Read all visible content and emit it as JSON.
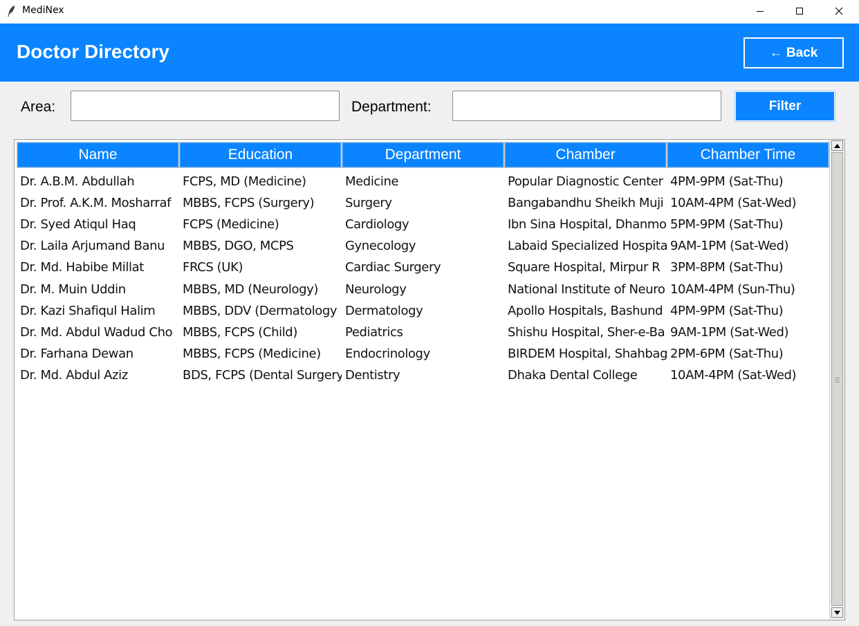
{
  "window": {
    "app_title": "MediNex",
    "icons": {
      "app": "feather-icon",
      "minimize": "minimize-icon",
      "maximize": "maximize-icon",
      "close": "close-icon"
    }
  },
  "header": {
    "title": "Doctor Directory",
    "back_label": "← Back"
  },
  "filters": {
    "area_label": "Area:",
    "area_value": "",
    "department_label": "Department:",
    "department_value": "",
    "filter_label": "Filter"
  },
  "table": {
    "columns": [
      "Name",
      "Education",
      "Department",
      "Chamber",
      "Chamber Time"
    ],
    "rows": [
      [
        "Dr. A.B.M. Abdullah",
        "FCPS, MD (Medicine)",
        "Medicine",
        "Popular Diagnostic Center",
        "4PM-9PM (Sat-Thu)"
      ],
      [
        "Dr. Prof. A.K.M. Mosharraf",
        "MBBS, FCPS (Surgery)",
        "Surgery",
        "Bangabandhu Sheikh Muji",
        "10AM-4PM (Sat-Wed)"
      ],
      [
        "Dr. Syed Atiqul Haq",
        "FCPS (Medicine)",
        "Cardiology",
        "Ibn Sina Hospital, Dhanmo",
        "5PM-9PM (Sat-Thu)"
      ],
      [
        "Dr. Laila Arjumand Banu",
        "MBBS, DGO, MCPS",
        "Gynecology",
        "Labaid Specialized Hospita",
        "9AM-1PM (Sat-Wed)"
      ],
      [
        "Dr. Md. Habibe Millat",
        "FRCS (UK)",
        "Cardiac Surgery",
        "Square Hospital, Mirpur R",
        "3PM-8PM (Sat-Thu)"
      ],
      [
        "Dr. M. Muin Uddin",
        "MBBS, MD (Neurology)",
        "Neurology",
        "National Institute of Neuro",
        "10AM-4PM (Sun-Thu)"
      ],
      [
        "Dr. Kazi Shafiqul Halim",
        "MBBS, DDV (Dermatology",
        "Dermatology",
        "Apollo Hospitals, Bashund",
        "4PM-9PM (Sat-Thu)"
      ],
      [
        "Dr. Md. Abdul Wadud Cho",
        "MBBS, FCPS (Child)",
        "Pediatrics",
        "Shishu Hospital, Sher-e-Ba",
        "9AM-1PM (Sat-Wed)"
      ],
      [
        "Dr. Farhana Dewan",
        "MBBS, FCPS (Medicine)",
        "Endocrinology",
        "BIRDEM Hospital, Shahbag",
        "2PM-6PM (Sat-Thu)"
      ],
      [
        "Dr. Md. Abdul Aziz",
        "BDS, FCPS (Dental Surgery",
        "Dentistry",
        "Dhaka Dental College",
        "10AM-4PM (Sat-Wed)"
      ]
    ]
  },
  "colors": {
    "accent": "#0a84ff",
    "background": "#f0f0f0"
  }
}
